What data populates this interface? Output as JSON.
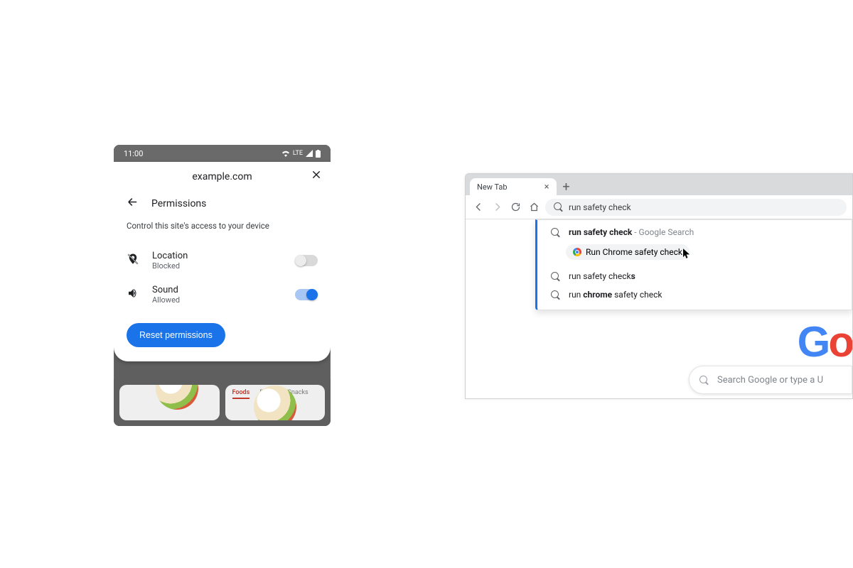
{
  "mobile": {
    "status": {
      "time": "11:00",
      "network": "LTE"
    },
    "site": "example.com",
    "permissions_title": "Permissions",
    "permissions_sub": "Control this site's access to your device",
    "items": [
      {
        "name": "Location",
        "state": "Blocked",
        "on": false
      },
      {
        "name": "Sound",
        "state": "Allowed",
        "on": true
      }
    ],
    "reset_label": "Reset permissions",
    "bg_tabs": [
      "Foods",
      "Drinks",
      "Snacks"
    ]
  },
  "desktop": {
    "tab_title": "New Tab",
    "omnibox_value": "run safety check",
    "suggestions": [
      {
        "text": "run safety check",
        "suffix": " - Google Search"
      },
      {
        "action": "Run Chrome safety check"
      },
      {
        "prefix": "run safety check",
        "bold": "s"
      },
      {
        "prefix": "run ",
        "bold": "chrome",
        "suffix": " safety check"
      }
    ],
    "ntp_search_placeholder": "Search Google or type a U"
  }
}
